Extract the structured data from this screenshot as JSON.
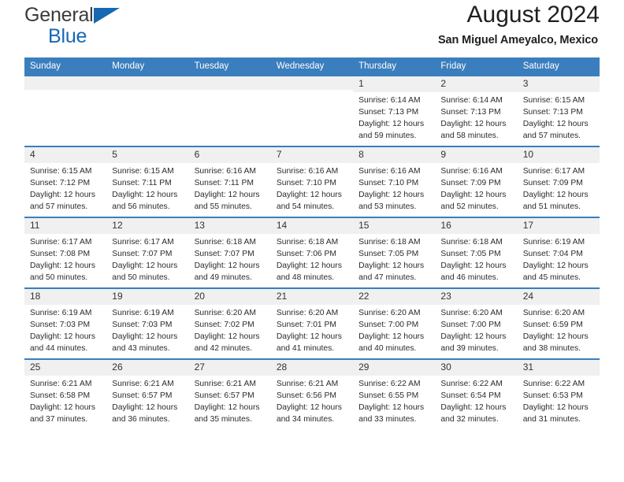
{
  "brand": {
    "line1": "General",
    "line2": "Blue",
    "triangle_color": "#1668b3",
    "text_color": "#3b3b3b"
  },
  "header": {
    "title": "August 2024",
    "subtitle": "San Miguel Ameyalco, Mexico",
    "accent_color": "#3a7ebe"
  },
  "calendar": {
    "weekday_headers": [
      "Sunday",
      "Monday",
      "Tuesday",
      "Wednesday",
      "Thursday",
      "Friday",
      "Saturday"
    ],
    "weeks": [
      [
        {
          "day": "",
          "lines": []
        },
        {
          "day": "",
          "lines": []
        },
        {
          "day": "",
          "lines": []
        },
        {
          "day": "",
          "lines": []
        },
        {
          "day": "1",
          "lines": [
            "Sunrise: 6:14 AM",
            "Sunset: 7:13 PM",
            "Daylight: 12 hours",
            "and 59 minutes."
          ]
        },
        {
          "day": "2",
          "lines": [
            "Sunrise: 6:14 AM",
            "Sunset: 7:13 PM",
            "Daylight: 12 hours",
            "and 58 minutes."
          ]
        },
        {
          "day": "3",
          "lines": [
            "Sunrise: 6:15 AM",
            "Sunset: 7:13 PM",
            "Daylight: 12 hours",
            "and 57 minutes."
          ]
        }
      ],
      [
        {
          "day": "4",
          "lines": [
            "Sunrise: 6:15 AM",
            "Sunset: 7:12 PM",
            "Daylight: 12 hours",
            "and 57 minutes."
          ]
        },
        {
          "day": "5",
          "lines": [
            "Sunrise: 6:15 AM",
            "Sunset: 7:11 PM",
            "Daylight: 12 hours",
            "and 56 minutes."
          ]
        },
        {
          "day": "6",
          "lines": [
            "Sunrise: 6:16 AM",
            "Sunset: 7:11 PM",
            "Daylight: 12 hours",
            "and 55 minutes."
          ]
        },
        {
          "day": "7",
          "lines": [
            "Sunrise: 6:16 AM",
            "Sunset: 7:10 PM",
            "Daylight: 12 hours",
            "and 54 minutes."
          ]
        },
        {
          "day": "8",
          "lines": [
            "Sunrise: 6:16 AM",
            "Sunset: 7:10 PM",
            "Daylight: 12 hours",
            "and 53 minutes."
          ]
        },
        {
          "day": "9",
          "lines": [
            "Sunrise: 6:16 AM",
            "Sunset: 7:09 PM",
            "Daylight: 12 hours",
            "and 52 minutes."
          ]
        },
        {
          "day": "10",
          "lines": [
            "Sunrise: 6:17 AM",
            "Sunset: 7:09 PM",
            "Daylight: 12 hours",
            "and 51 minutes."
          ]
        }
      ],
      [
        {
          "day": "11",
          "lines": [
            "Sunrise: 6:17 AM",
            "Sunset: 7:08 PM",
            "Daylight: 12 hours",
            "and 50 minutes."
          ]
        },
        {
          "day": "12",
          "lines": [
            "Sunrise: 6:17 AM",
            "Sunset: 7:07 PM",
            "Daylight: 12 hours",
            "and 50 minutes."
          ]
        },
        {
          "day": "13",
          "lines": [
            "Sunrise: 6:18 AM",
            "Sunset: 7:07 PM",
            "Daylight: 12 hours",
            "and 49 minutes."
          ]
        },
        {
          "day": "14",
          "lines": [
            "Sunrise: 6:18 AM",
            "Sunset: 7:06 PM",
            "Daylight: 12 hours",
            "and 48 minutes."
          ]
        },
        {
          "day": "15",
          "lines": [
            "Sunrise: 6:18 AM",
            "Sunset: 7:05 PM",
            "Daylight: 12 hours",
            "and 47 minutes."
          ]
        },
        {
          "day": "16",
          "lines": [
            "Sunrise: 6:18 AM",
            "Sunset: 7:05 PM",
            "Daylight: 12 hours",
            "and 46 minutes."
          ]
        },
        {
          "day": "17",
          "lines": [
            "Sunrise: 6:19 AM",
            "Sunset: 7:04 PM",
            "Daylight: 12 hours",
            "and 45 minutes."
          ]
        }
      ],
      [
        {
          "day": "18",
          "lines": [
            "Sunrise: 6:19 AM",
            "Sunset: 7:03 PM",
            "Daylight: 12 hours",
            "and 44 minutes."
          ]
        },
        {
          "day": "19",
          "lines": [
            "Sunrise: 6:19 AM",
            "Sunset: 7:03 PM",
            "Daylight: 12 hours",
            "and 43 minutes."
          ]
        },
        {
          "day": "20",
          "lines": [
            "Sunrise: 6:20 AM",
            "Sunset: 7:02 PM",
            "Daylight: 12 hours",
            "and 42 minutes."
          ]
        },
        {
          "day": "21",
          "lines": [
            "Sunrise: 6:20 AM",
            "Sunset: 7:01 PM",
            "Daylight: 12 hours",
            "and 41 minutes."
          ]
        },
        {
          "day": "22",
          "lines": [
            "Sunrise: 6:20 AM",
            "Sunset: 7:00 PM",
            "Daylight: 12 hours",
            "and 40 minutes."
          ]
        },
        {
          "day": "23",
          "lines": [
            "Sunrise: 6:20 AM",
            "Sunset: 7:00 PM",
            "Daylight: 12 hours",
            "and 39 minutes."
          ]
        },
        {
          "day": "24",
          "lines": [
            "Sunrise: 6:20 AM",
            "Sunset: 6:59 PM",
            "Daylight: 12 hours",
            "and 38 minutes."
          ]
        }
      ],
      [
        {
          "day": "25",
          "lines": [
            "Sunrise: 6:21 AM",
            "Sunset: 6:58 PM",
            "Daylight: 12 hours",
            "and 37 minutes."
          ]
        },
        {
          "day": "26",
          "lines": [
            "Sunrise: 6:21 AM",
            "Sunset: 6:57 PM",
            "Daylight: 12 hours",
            "and 36 minutes."
          ]
        },
        {
          "day": "27",
          "lines": [
            "Sunrise: 6:21 AM",
            "Sunset: 6:57 PM",
            "Daylight: 12 hours",
            "and 35 minutes."
          ]
        },
        {
          "day": "28",
          "lines": [
            "Sunrise: 6:21 AM",
            "Sunset: 6:56 PM",
            "Daylight: 12 hours",
            "and 34 minutes."
          ]
        },
        {
          "day": "29",
          "lines": [
            "Sunrise: 6:22 AM",
            "Sunset: 6:55 PM",
            "Daylight: 12 hours",
            "and 33 minutes."
          ]
        },
        {
          "day": "30",
          "lines": [
            "Sunrise: 6:22 AM",
            "Sunset: 6:54 PM",
            "Daylight: 12 hours",
            "and 32 minutes."
          ]
        },
        {
          "day": "31",
          "lines": [
            "Sunrise: 6:22 AM",
            "Sunset: 6:53 PM",
            "Daylight: 12 hours",
            "and 31 minutes."
          ]
        }
      ]
    ]
  }
}
